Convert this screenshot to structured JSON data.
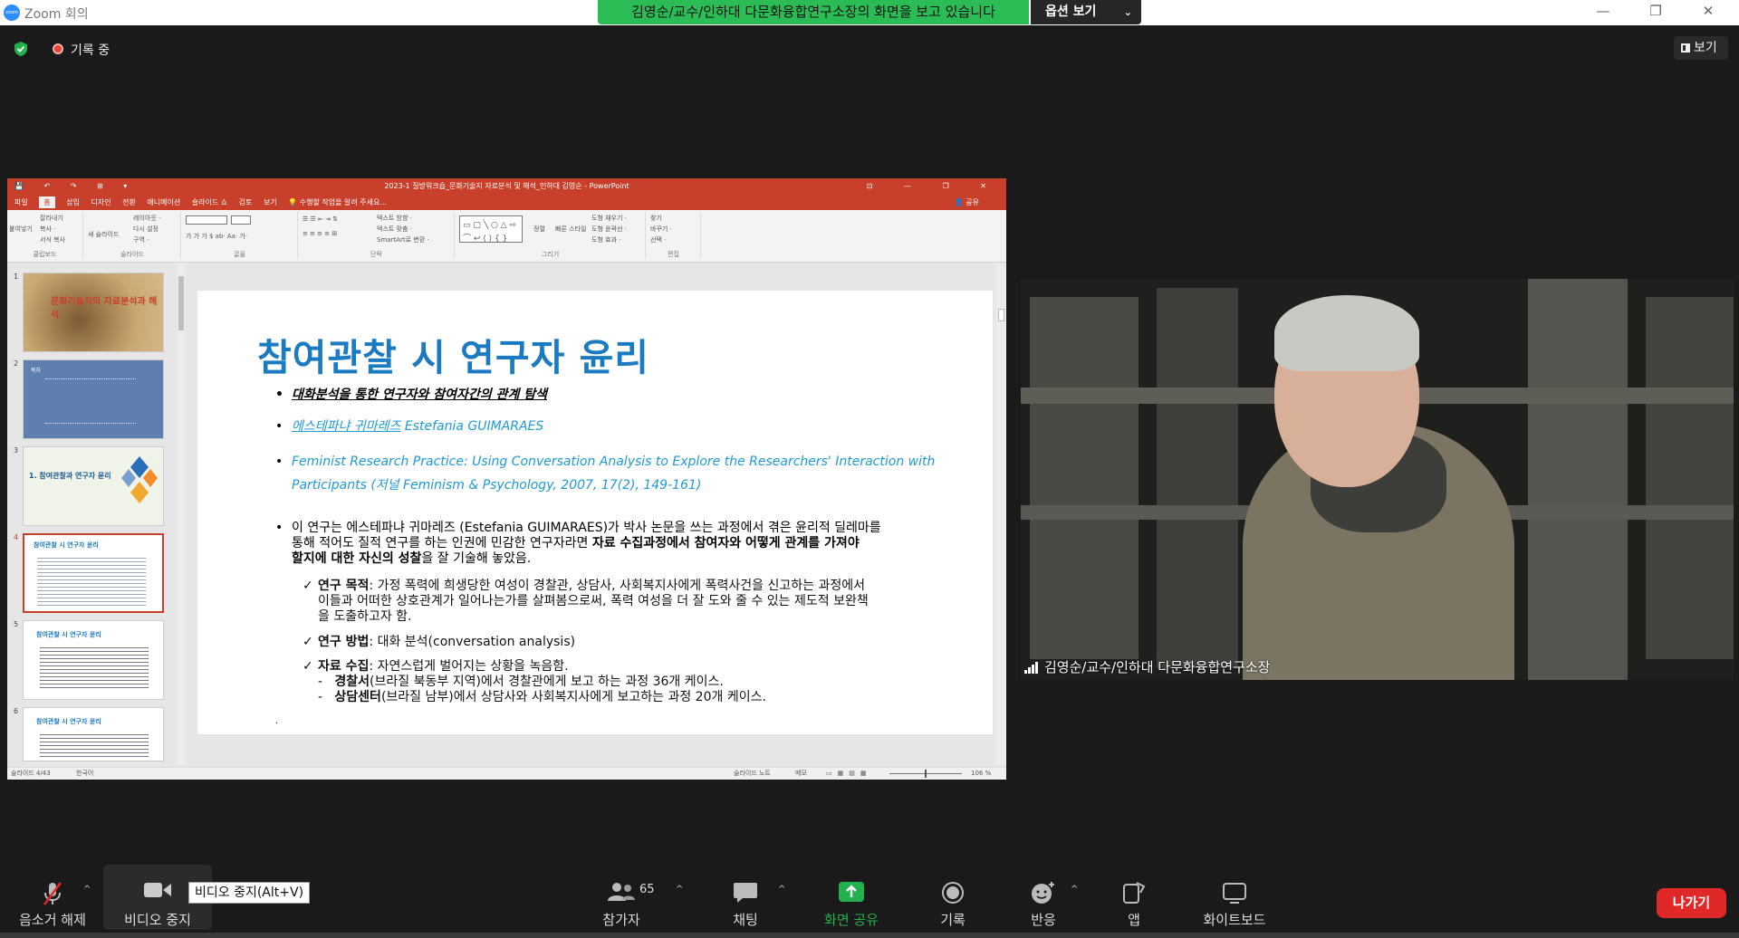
{
  "window": {
    "title": "Zoom 회의",
    "logo_text": "zoom",
    "minimize": "—",
    "restore": "❐",
    "close": "✕"
  },
  "share_banner": {
    "text": "김영순/교수/인하대 다문화융합연구소장의 화면을 보고 있습니다",
    "options_label": "옵션 보기",
    "chevron": "⌄"
  },
  "status": {
    "recording_label": "기록 중",
    "view_label": "보기"
  },
  "ppt": {
    "title": "2023-1 질방워크숍_문화기술지 자료분석 및 해석_인하대 김영순 - PowerPoint",
    "quick_access": "💾 ↶ ↷ ⊞ ▾",
    "window_controls": "⊡ — ❐ ✕",
    "menu": [
      "파일",
      "홈",
      "삽입",
      "디자인",
      "전환",
      "애니메이션",
      "슬라이드 쇼",
      "검토",
      "보기"
    ],
    "active_menu": "홈",
    "tell_me": "수행할 작업을 알려 주세요...",
    "share": "공유",
    "ribbon_groups": [
      "클립보드",
      "슬라이드",
      "글꼴",
      "단락",
      "그리기",
      "편집"
    ],
    "ribbon_items": {
      "clipboard": [
        "잘라내기",
        "복사 ·",
        "서식 복사"
      ],
      "paste": "붙여넣기",
      "slides": [
        "레이아웃 ·",
        "다시 설정",
        "구역 ·"
      ],
      "new_slide": "새 슬라이드",
      "font_row": "가 가 가 $ ab· Aa· 가·",
      "para_items": [
        "텍스트 방향 ·",
        "텍스트 맞춤 ·",
        "SmartArt로 변환 ·"
      ],
      "arrange": "정렬",
      "quick_styles": "빠른 스타일",
      "shape_items": [
        "도형 채우기 ·",
        "도형 윤곽선 ·",
        "도형 효과 ·"
      ],
      "edit_items": [
        "찾기",
        "바꾸기 ·",
        "선택 ·"
      ]
    },
    "thumbnails": [
      {
        "num": "1",
        "text": "문화기술지의 자료분석과 해석"
      },
      {
        "num": "2",
        "text": "목차"
      },
      {
        "num": "3",
        "text": "1. 참여관찰과 연구자 윤리"
      },
      {
        "num": "4",
        "text": "참여관찰 시 연구자 윤리"
      },
      {
        "num": "5",
        "text": "참여관찰 시 연구자 윤리"
      },
      {
        "num": "6",
        "text": "참여관찰 시 연구자 윤리"
      }
    ],
    "statusbar": {
      "slide_info": "슬라이드 4/43",
      "language": "한국어",
      "notes": "슬라이드 노트",
      "comments": "메모",
      "zoom": "106 %"
    }
  },
  "slide": {
    "title": "참여관찰 시 연구자 윤리",
    "b1": "대화분석을 통한 연구자와 참여자간의 관계 탐색",
    "b2_ko": "에스테파냐 귀마레즈",
    "b2_en": " Estefania GUIMARAES",
    "b3_line1": "Feminist Research Practice: Using Conversation Analysis to Explore the Researchers' Interaction with",
    "b3_line2": "Participants (저널 Feminism & Psychology, 2007, 17(2), 149-161)",
    "b4_a": "이 연구는 에스테파냐 귀마레즈 (Estefania GUIMARAES)가 박사 논문을 쓰는 과정에서 겪은 윤리적 딜레마를",
    "b4_b": "통해 적어도 질적 연구를 하는 인권에 민감한 연구자라면 ",
    "b4_bold1": "자료 수집과정에서 참여자와 어떻게 관계를 가져야",
    "b4_bold2": "할지에 대한 자신의 성찰",
    "b4_c": "을 잘 기술해 놓았음.",
    "c1_label": "연구 목적",
    "c1_a": ": 가정 폭력에 희생당한 여성이 경찰관, 상담사, 사회복지사에게 폭력사건을 신고하는 과정에서",
    "c1_b": "이들과 어떠한 상호관계가 일어나는가를 살펴봄으로써, 폭력 여성을 더 잘 도와 줄 수 있는 제도적 보완책",
    "c1_c": "을 도출하고자 함.",
    "c2_label": "연구 방법",
    "c2_text": ": 대화 분석(conversation analysis)",
    "c3_label": "자료 수집",
    "c3_text": ": 자연스럽게 벌어지는 상황을 녹음함.",
    "d1_label": "경찰서",
    "d1_text": "(브라질 북동부 지역)에서 경찰관에게 보고 하는 과정 36개 케이스.",
    "d2_label": "상담센터",
    "d2_text": "(브라질 남부)에서 상담사와 사회복지사에게 보고하는 과정 20개 케이스.",
    "trailing": "."
  },
  "video": {
    "participant_name": "김영순/교수/인하대 다문화융합연구소장"
  },
  "toolbar": {
    "mute_label": "음소거 해제",
    "video_label": "비디오 중지",
    "video_tooltip": "비디오 중지(Alt+V)",
    "participants_label": "참가자",
    "participants_count": "65",
    "chat_label": "채팅",
    "share_label": "화면 공유",
    "record_label": "기록",
    "reactions_label": "반응",
    "apps_label": "앱",
    "whiteboard_label": "화이트보드",
    "leave_label": "나가기",
    "caret": "^"
  },
  "colors": {
    "share_green": "#2bbc55",
    "leave_red": "#e02828",
    "ppt_red": "#c8402b",
    "slide_title_blue": "#1a7ac2",
    "link_blue": "#1e9ad6"
  }
}
